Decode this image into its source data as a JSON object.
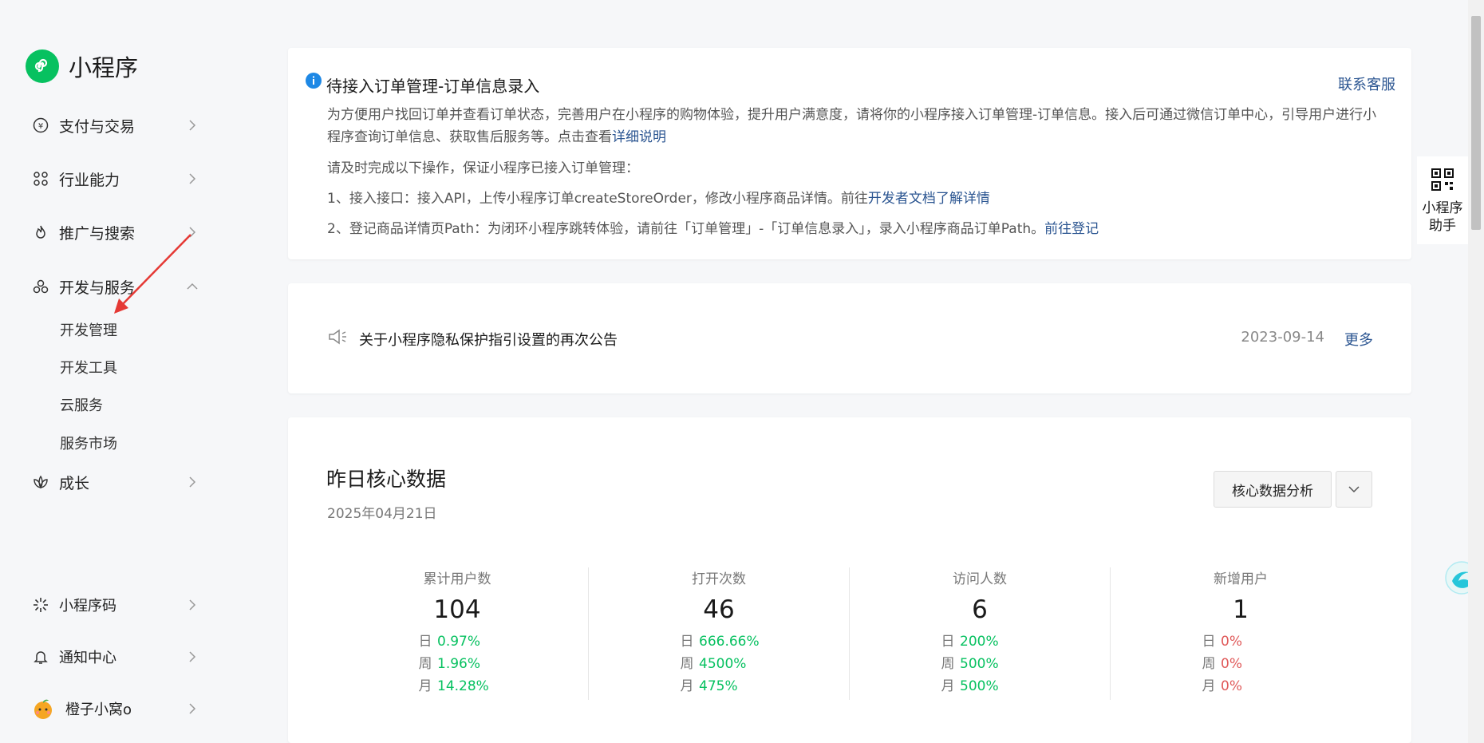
{
  "sidebar": {
    "logo_text": "小程序",
    "items": [
      {
        "label": "支付与交易",
        "icon": "yen-circle-icon"
      },
      {
        "label": "行业能力",
        "icon": "grid-icon"
      },
      {
        "label": "推广与搜索",
        "icon": "flame-icon"
      },
      {
        "label": "开发与服务",
        "icon": "cluster-icon"
      },
      {
        "label": "成长",
        "icon": "lotus-icon"
      }
    ],
    "sub_items": [
      "开发管理",
      "开发工具",
      "云服务",
      "服务市场"
    ],
    "bottom_items": [
      {
        "label": "小程序码",
        "icon": "code-icon"
      },
      {
        "label": "通知中心",
        "icon": "bell-icon"
      },
      {
        "label": "橙子小窝o",
        "icon": "avatar"
      }
    ]
  },
  "notice": {
    "title": "待接入订单管理-订单信息录入",
    "contact": "联系客服",
    "body_prefix": "为方便用户找回订单并查看订单状态，完善用户在小程序的购物体验，提升用户满意度，请将你的小程序接入订单管理-订单信息。接入后可通过微信订单中心，引导用户进行小程序查询订单信息、获取售后服务等。点击查看",
    "body_link": "详细说明",
    "line1": "请及时完成以下操作，保证小程序已接入订单管理：",
    "line2_prefix": "1、接入接口：接入API，上传小程序订单createStoreOrder，修改小程序商品详情。前往",
    "line2_link": "开发者文档了解详情",
    "line3_prefix": "2、登记商品详情页Path：为闭环小程序跳转体验，请前往「订单管理」-「订单信息录入」，录入小程序商品订单Path。",
    "line3_link": "前往登记"
  },
  "announcement": {
    "text": "关于小程序隐私保护指引设置的再次公告",
    "date": "2023-09-14",
    "more": "更多"
  },
  "core": {
    "title": "昨日核心数据",
    "date": "2025年04月21日",
    "analysis_button": "核心数据分析",
    "stats": [
      {
        "label": "累计用户数",
        "value": "104",
        "rows": [
          {
            "k": "日",
            "v": "0.97%"
          },
          {
            "k": "周",
            "v": "1.96%"
          },
          {
            "k": "月",
            "v": "14.28%"
          }
        ],
        "trend": "up"
      },
      {
        "label": "打开次数",
        "value": "46",
        "rows": [
          {
            "k": "日",
            "v": "666.66%"
          },
          {
            "k": "周",
            "v": "4500%"
          },
          {
            "k": "月",
            "v": "475%"
          }
        ],
        "trend": "up"
      },
      {
        "label": "访问人数",
        "value": "6",
        "rows": [
          {
            "k": "日",
            "v": "200%"
          },
          {
            "k": "周",
            "v": "500%"
          },
          {
            "k": "月",
            "v": "500%"
          }
        ],
        "trend": "up"
      },
      {
        "label": "新增用户",
        "value": "1",
        "rows": [
          {
            "k": "日",
            "v": "0%"
          },
          {
            "k": "周",
            "v": "0%"
          },
          {
            "k": "月",
            "v": "0%"
          }
        ],
        "trend": "zero"
      }
    ]
  },
  "helper": {
    "line1": "小程序",
    "line2": "助手"
  },
  "colors": {
    "brand": "#07c160",
    "link": "#2b5591",
    "negative": "#e05a5a",
    "annotation_arrow": "#e53935"
  }
}
